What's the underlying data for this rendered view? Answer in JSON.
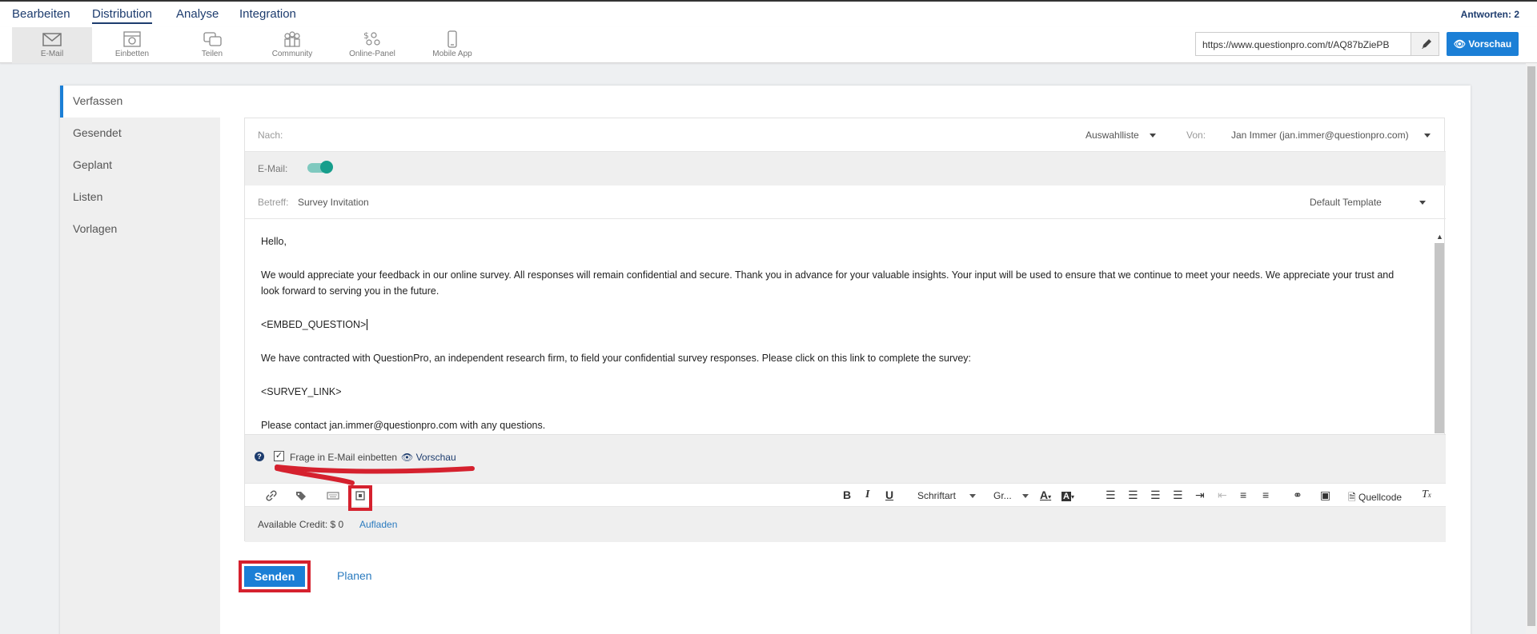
{
  "topnav": {
    "tabs": [
      {
        "label": "Bearbeiten"
      },
      {
        "label": "Distribution"
      },
      {
        "label": "Analyse"
      },
      {
        "label": "Integration"
      }
    ],
    "answers": "Antworten: 2"
  },
  "subbar": {
    "items": [
      {
        "label": "E-Mail",
        "icon": "envelope-icon"
      },
      {
        "label": "Einbetten",
        "icon": "embed-icon"
      },
      {
        "label": "Teilen",
        "icon": "share-icon"
      },
      {
        "label": "Community",
        "icon": "community-icon"
      },
      {
        "label": "Online-Panel",
        "icon": "panel-icon"
      },
      {
        "label": "Mobile App",
        "icon": "mobile-icon"
      }
    ],
    "url": "https://www.questionpro.com/t/AQ87bZiePB",
    "preview_label": "Vorschau"
  },
  "sidebar": {
    "items": [
      {
        "label": "Verfassen"
      },
      {
        "label": "Gesendet"
      },
      {
        "label": "Geplant"
      },
      {
        "label": "Listen"
      },
      {
        "label": "Vorlagen"
      }
    ]
  },
  "composer": {
    "to_label": "Nach:",
    "list_select": "Auswahlliste",
    "from_label": "Von:",
    "from_value": "Jan Immer (jan.immer@questionpro.com)",
    "email_label": "E-Mail:",
    "subject_label": "Betreff:",
    "subject_value": "Survey Invitation",
    "template_select": "Default Template",
    "body": {
      "p1": "Hello,",
      "p2": "We would appreciate your feedback in our online survey. All responses will remain confidential and secure. Thank you in advance for your valuable insights. Your input will be used to ensure that we continue to meet your needs. We appreciate your trust and look forward to serving you in the future.",
      "p3": "<EMBED_QUESTION>",
      "p4": "We have contracted with QuestionPro, an independent research firm, to field your confidential survey responses. Please click on this link to complete the survey:",
      "p5": "<SURVEY_LINK>",
      "p6": "Please contact jan.immer@questionpro.com with any questions."
    },
    "embed_label": "Frage in E-Mail einbetten",
    "embed_preview": "Vorschau",
    "toolbar": {
      "font_select": "Schriftart",
      "size_select": "Gr...",
      "source_label": "Quellcode"
    },
    "credit_label": "Available Credit: $ 0",
    "credit_link": "Aufladen"
  },
  "actions": {
    "send_label": "Senden",
    "plan_label": "Planen"
  }
}
